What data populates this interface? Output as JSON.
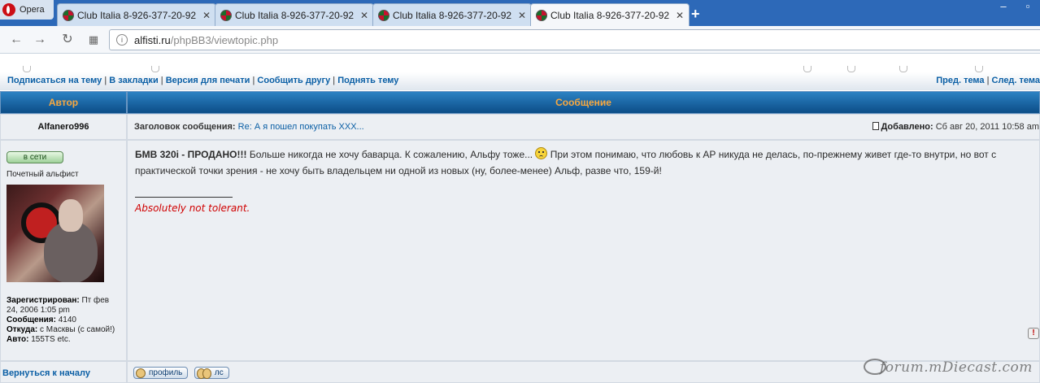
{
  "browser": {
    "menu_label": "Opera",
    "tabs": [
      {
        "title": "Club Italia 8-926-377-20-92"
      },
      {
        "title": "Club Italia 8-926-377-20-92"
      },
      {
        "title": "Club Italia 8-926-377-20-92"
      },
      {
        "title": "Club Italia 8-926-377-20-92",
        "active": true
      }
    ],
    "url_host": "alfisti.ru",
    "url_path": "/phpBB3/viewtopic.php"
  },
  "topic_links": {
    "subscribe": "Подписаться на тему",
    "bookmark": "В закладки",
    "print": "Версия для печати",
    "tell_friend": "Сообщить другу",
    "bump": "Поднять тему",
    "prev": "Пред. тема",
    "next": "След. тема"
  },
  "table": {
    "col_author": "Автор",
    "col_message": "Сообщение"
  },
  "post": {
    "author": "Alfanero996",
    "subject_label": "Заголовок сообщения:",
    "subject": "Re: А я пошел покупать XXX...",
    "posted_label": "Добавлено:",
    "posted_date": "Сб авг 20, 2011 10:58 am",
    "online_label": "в сети",
    "rank": "Почетный альфист",
    "registered_label": "Зарегистрирован:",
    "registered_value": "Пт фев 24, 2006 1:05 pm",
    "posts_label": "Сообщения:",
    "posts_value": "4140",
    "location_label": "Откуда:",
    "location_value": "с Масквы (с самой!)",
    "car_label": "Авто:",
    "car_value": "155TS etc.",
    "body_bold": "БМВ 320i - ПРОДАНО!!!",
    "body_part1": " Больше никогда не хочу баварца. К сожалению, Альфу тоже... ",
    "body_part2": " При этом понимаю, что любовь к АР никуда не делась, по-прежнему живет где-то внутри, но вот с практической точки зрения - не хочу быть владельцем ни одной из новых (ну, более-менее) Альф, разве что, 159-й!",
    "signature": "Absolutely not tolerant.",
    "report_icon": "!"
  },
  "footer": {
    "back_to_top": "Вернуться к началу",
    "profile_button": "профиль",
    "pm_button": "лс"
  },
  "watermark": "forum.mDiecast.com"
}
